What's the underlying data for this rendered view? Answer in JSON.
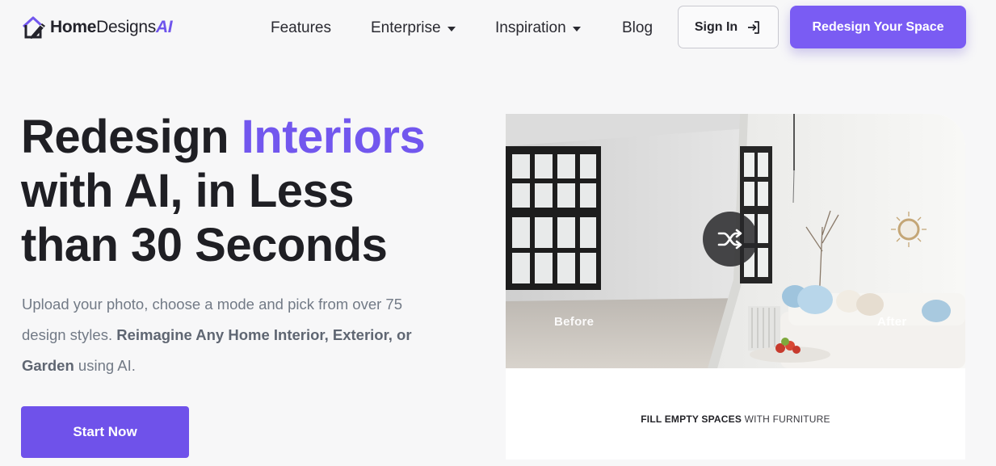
{
  "logo": {
    "home": "Home",
    "designs": "Designs",
    "ai": "AI"
  },
  "nav": {
    "features": "Features",
    "enterprise": "Enterprise",
    "inspiration": "Inspiration",
    "blog": "Blog",
    "sign_in": "Sign In",
    "cta": "Redesign Your Space"
  },
  "hero": {
    "title_1": "Redesign ",
    "title_accent": "Interiors",
    "title_2": "with AI, in Less",
    "title_3": "than 30 Seconds",
    "desc_1": "Upload your photo, choose a mode and pick from over 75 design styles. ",
    "desc_bold": "Reimagine Any Home Interior, Exterior, or Garden",
    "desc_2": " using AI.",
    "start_button": "Start Now"
  },
  "card": {
    "before_label": "Before",
    "after_label": "After",
    "caption_bold": "FILL EMPTY SPACES",
    "caption_rest": " WITH FURNITURE"
  },
  "colors": {
    "accent": "#7257ee",
    "button": "#6f52ea",
    "text_dark": "#1f1f24",
    "text_muted": "#727a86"
  },
  "icons": {
    "logo": "house-pen-icon",
    "sign_in": "sign-in-arrow-icon",
    "swap": "shuffle-icon"
  }
}
